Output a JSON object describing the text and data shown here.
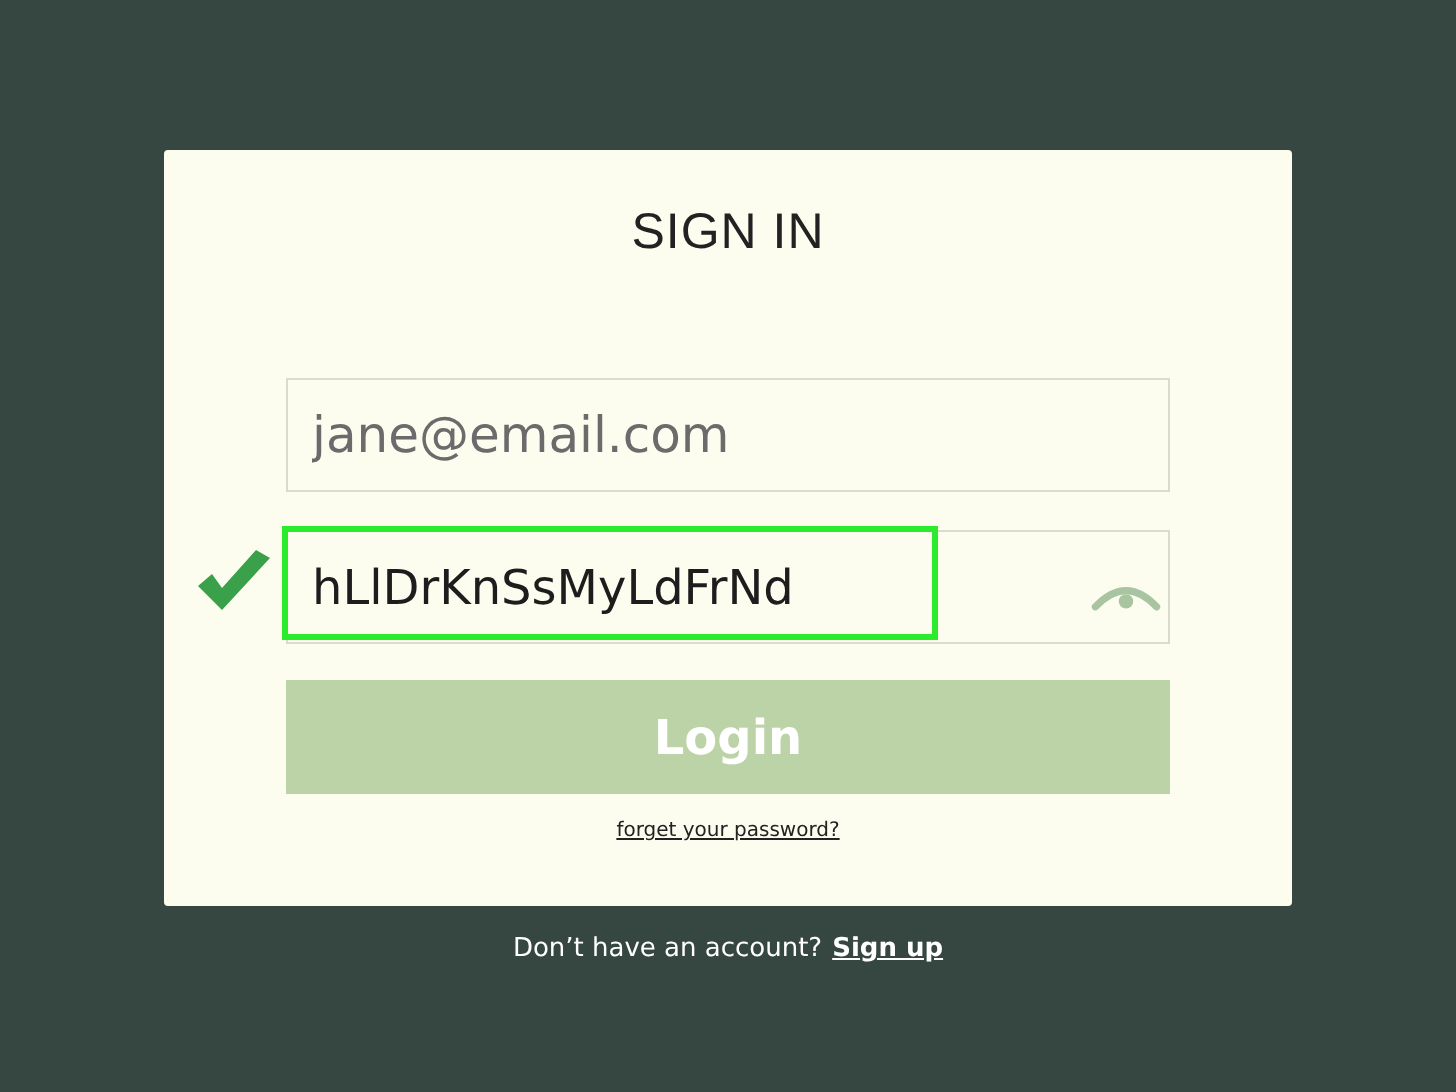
{
  "card": {
    "title": "SIGN IN"
  },
  "email_field": {
    "placeholder": "jane@email.com"
  },
  "password_field": {
    "value": "hLlDrKnSsMyLdFrNd",
    "valid": true,
    "highlighted": true
  },
  "login_button": {
    "label": "Login",
    "disabled": true
  },
  "forgot_link": "forget your password?",
  "footer": {
    "text": "Don’t have an account?",
    "link": "Sign up"
  }
}
